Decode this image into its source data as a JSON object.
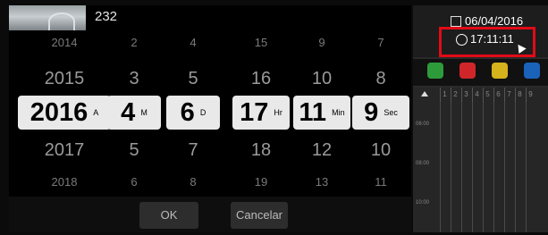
{
  "header": {
    "title_value": "232"
  },
  "picker": {
    "columns": [
      {
        "key": "year",
        "values": [
          "2014",
          "2015",
          "2016",
          "2017",
          "2018"
        ],
        "unit": "A"
      },
      {
        "key": "month",
        "values": [
          "2",
          "3",
          "4",
          "5",
          "6"
        ],
        "unit": "M"
      },
      {
        "key": "day",
        "values": [
          "4",
          "5",
          "6",
          "7",
          "8"
        ],
        "unit": "D"
      },
      {
        "key": "hour",
        "values": [
          "15",
          "16",
          "17",
          "18",
          "19"
        ],
        "unit": "Hr"
      },
      {
        "key": "minute",
        "values": [
          "9",
          "10",
          "11",
          "12",
          "13"
        ],
        "unit": "Min"
      },
      {
        "key": "second",
        "values": [
          "7",
          "8",
          "9",
          "10",
          "11"
        ],
        "unit": "Sec"
      }
    ],
    "ok_label": "OK",
    "cancel_label": "Cancelar"
  },
  "right_panel": {
    "date": "06/04/2016",
    "time": "17:11:11",
    "channel_headers": [
      "1",
      "2",
      "3",
      "4",
      "5",
      "6",
      "7",
      "8",
      "9"
    ],
    "time_labels": [
      "06:00",
      "08:00",
      "10:00"
    ],
    "icons": [
      {
        "name": "green-person-icon",
        "color": "#2e9b3a"
      },
      {
        "name": "red-person-icon",
        "color": "#d0262a"
      },
      {
        "name": "yellow-run-icon",
        "color": "#d6b21c"
      },
      {
        "name": "blue-icon",
        "color": "#1a63b9"
      }
    ],
    "highlight_color": "#e10b17"
  }
}
